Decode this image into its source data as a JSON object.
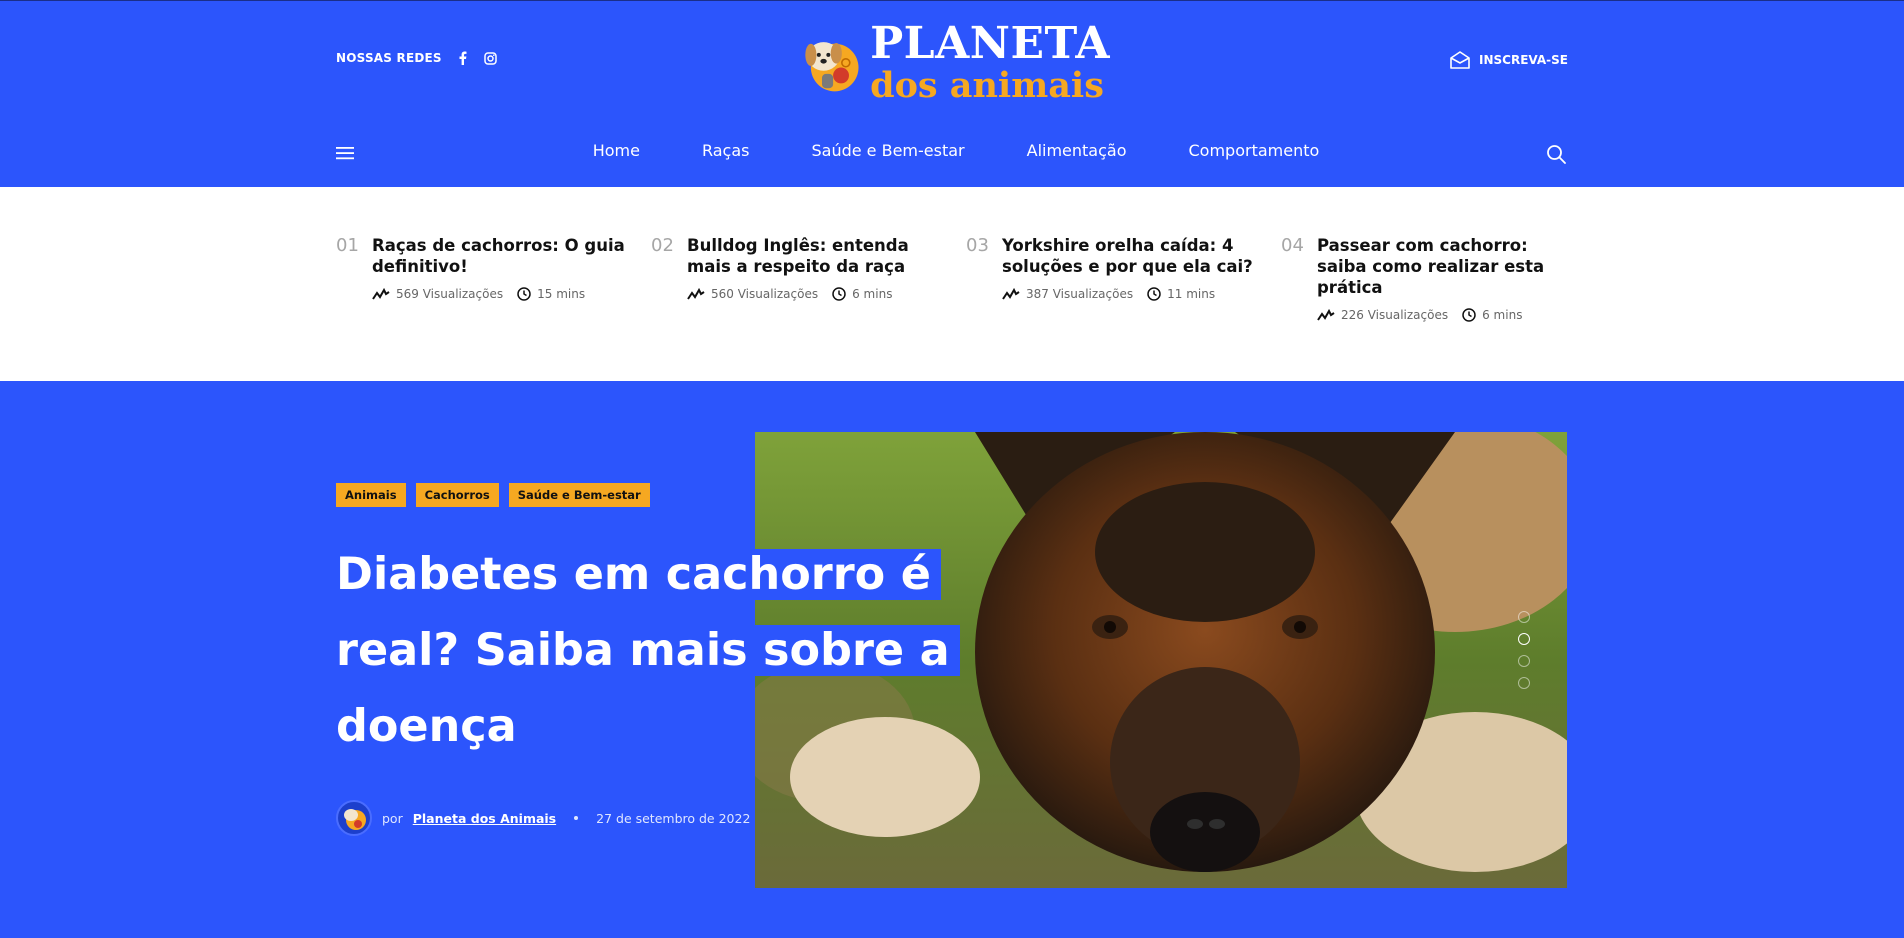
{
  "header": {
    "social_label": "NOSSAS REDES",
    "social_icons": [
      "facebook-icon",
      "instagram-icon"
    ],
    "logo_line1": "PLANETA",
    "logo_line2": "dos animais",
    "subscribe_label": "INSCREVA-SE"
  },
  "nav": {
    "items": [
      "Home",
      "Raças",
      "Saúde e Bem-estar",
      "Alimentação",
      "Comportamento"
    ]
  },
  "trending": [
    {
      "num": "01",
      "title": "Raças de cachorros: O guia definitivo!",
      "views": "569 Visualizações",
      "time": "15 mins"
    },
    {
      "num": "02",
      "title": "Bulldog Inglês: entenda mais a respeito da raça",
      "views": "560 Visualizações",
      "time": "6 mins"
    },
    {
      "num": "03",
      "title": "Yorkshire orelha caída: 4 soluções e por que ela cai?",
      "views": "387 Visualizações",
      "time": "11 mins"
    },
    {
      "num": "04",
      "title": "Passear com cachorro: saiba como realizar esta prática",
      "views": "226 Visualizações",
      "time": "6 mins"
    }
  ],
  "hero": {
    "categories": [
      "Animais",
      "Cachorros",
      "Saúde e Bem-estar"
    ],
    "title": "Diabetes em cachorro é real? Saiba mais sobre a doença",
    "by": "por",
    "author": "Planeta dos Animais",
    "date": "27 de setembro de 2022"
  },
  "colors": {
    "brand_blue": "#2c55fc",
    "accent_orange": "#f6a821"
  }
}
